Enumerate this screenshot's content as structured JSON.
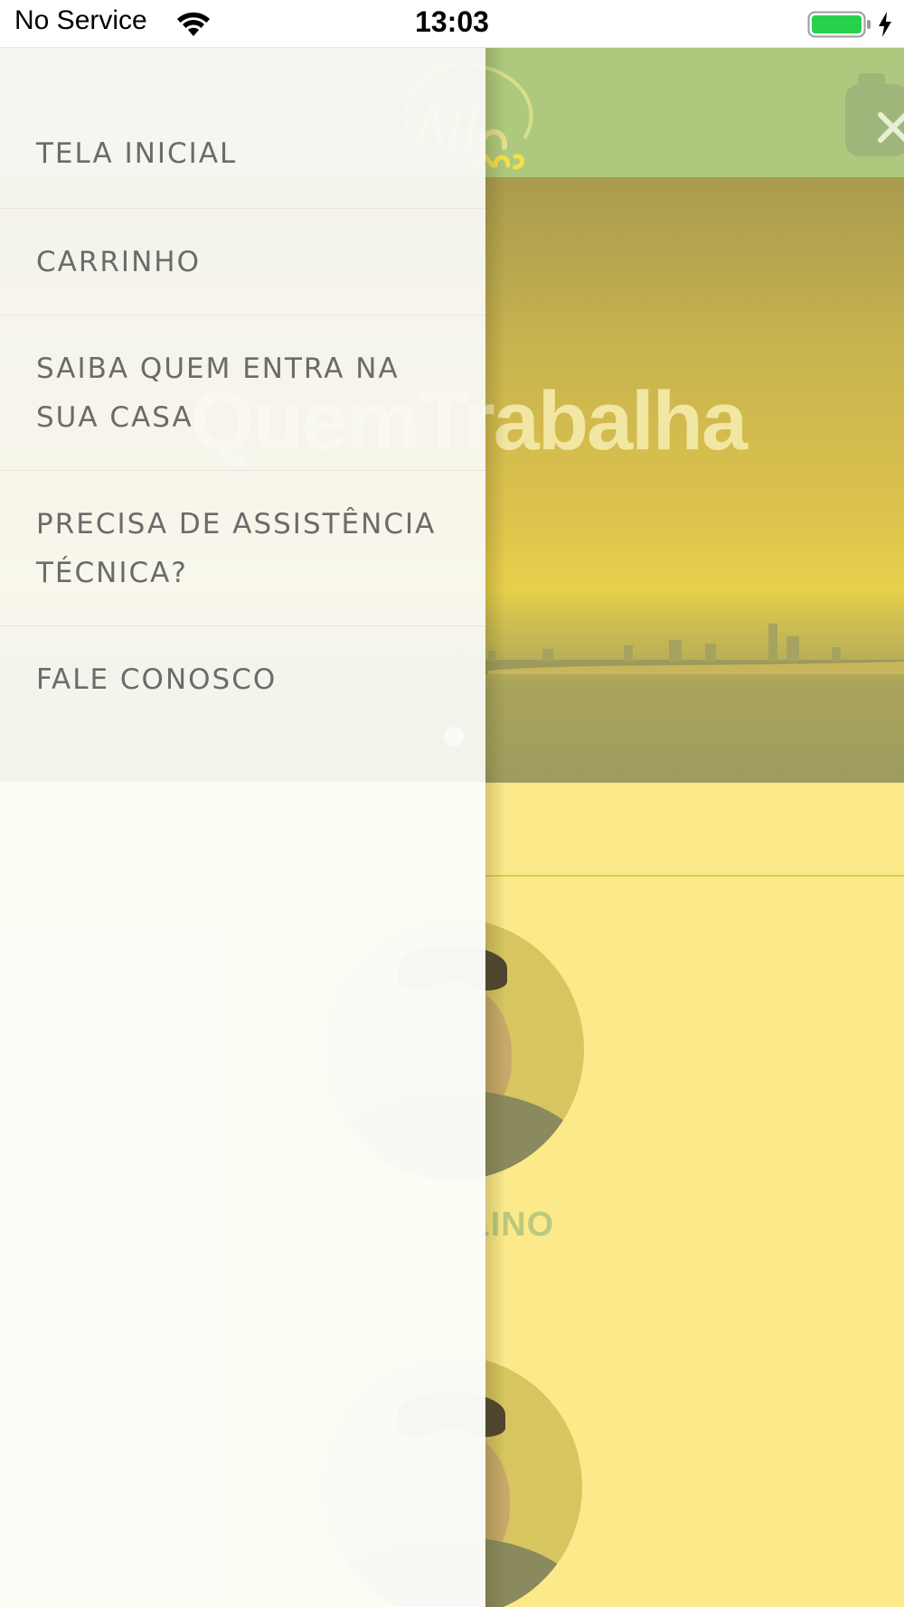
{
  "status_bar": {
    "carrier": "No Service",
    "time": "13:03",
    "battery_color": "#27d14a"
  },
  "app": {
    "header_color": "#aec97e",
    "hero_title": "QuemTrabalha",
    "workers": [
      {
        "name": "JUSCELINO"
      }
    ],
    "accent_color": "#fbe98a"
  },
  "drawer": {
    "items": [
      {
        "label": "TELA INICIAL"
      },
      {
        "label": "CARRINHO"
      },
      {
        "label": "SAIBA QUEM ENTRA NA SUA CASA"
      },
      {
        "label": "PRECISA DE ASSISTÊNCIA TÉCNICA?"
      },
      {
        "label": "FALE CONOSCO"
      }
    ]
  },
  "icons": {
    "wifi": "wifi-icon",
    "battery": "battery-icon",
    "charging": "charging-bolt-icon",
    "close": "close-icon",
    "gas": "gas-cylinder-icon"
  }
}
